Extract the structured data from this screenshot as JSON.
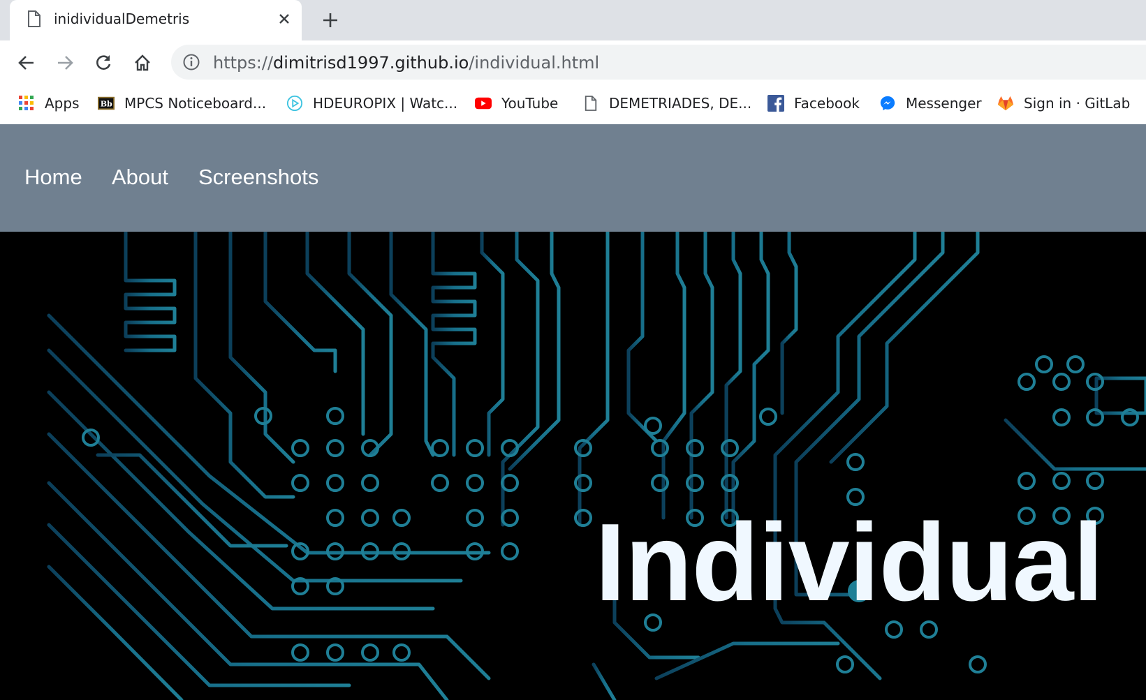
{
  "browser": {
    "tab": {
      "title": "inidividualDemetris",
      "icon": "document-icon"
    },
    "address": {
      "scheme": "https://",
      "host": "dimitrisd1997.github.io",
      "path": "/individual.html"
    },
    "bookmarks": [
      {
        "label": "Apps",
        "icon": "apps-grid-icon"
      },
      {
        "label": "MPCS Noticeboard...",
        "icon": "blackboard-icon"
      },
      {
        "label": "HDEUROPIX | Watc...",
        "icon": "play-circle-icon"
      },
      {
        "label": "YouTube",
        "icon": "youtube-icon"
      },
      {
        "label": "DEMETRIADES, DE...",
        "icon": "document-icon"
      },
      {
        "label": "Facebook",
        "icon": "facebook-icon"
      },
      {
        "label": "Messenger",
        "icon": "messenger-icon"
      },
      {
        "label": "Sign in · GitLab",
        "icon": "gitlab-icon"
      }
    ]
  },
  "site": {
    "nav": [
      {
        "label": "Home"
      },
      {
        "label": "About"
      },
      {
        "label": "Screenshots"
      }
    ],
    "hero_title": "Individual"
  },
  "colors": {
    "nav_bg": "#708090",
    "circuit": "#1f7f96",
    "hero_text": "#f0f8ff"
  }
}
